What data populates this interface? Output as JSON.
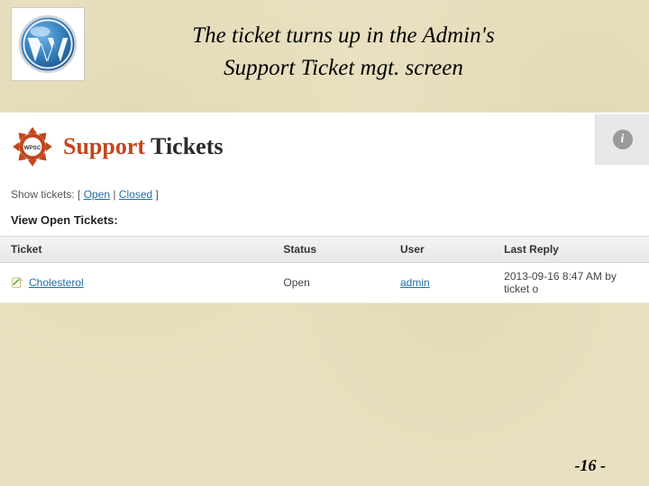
{
  "caption": {
    "line1": "The ticket turns up in the Admin's",
    "line2": "Support Ticket mgt. screen"
  },
  "header": {
    "brand_prefix": "WPSC",
    "brand_support": "Support",
    "brand_tickets": " Tickets",
    "info_glyph": "i"
  },
  "filter": {
    "prefix": "Show tickets: [ ",
    "open": "Open",
    "sep": " | ",
    "closed": "Closed",
    "suffix": " ]"
  },
  "view_heading": "View Open Tickets:",
  "columns": {
    "ticket": "Ticket",
    "status": "Status",
    "user": "User",
    "last_reply": "Last Reply"
  },
  "rows": [
    {
      "ticket": "Cholesterol",
      "status": "Open",
      "user": "admin",
      "last_reply": "2013-09-16 8:47 AM by ticket o"
    }
  ],
  "page_number": "-16 -"
}
